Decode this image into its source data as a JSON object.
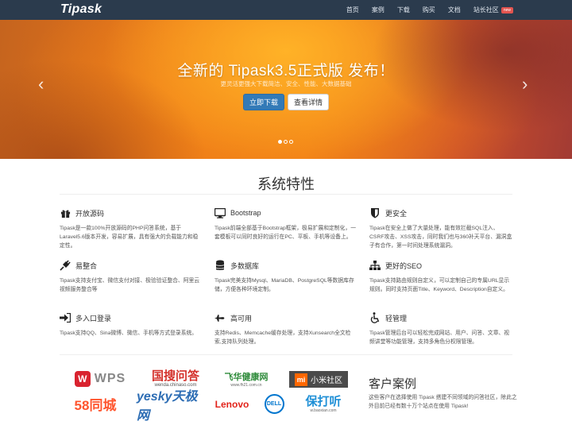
{
  "navbar": {
    "brand": "Tipask",
    "items": [
      {
        "label": "首页"
      },
      {
        "label": "案例"
      },
      {
        "label": "下载"
      },
      {
        "label": "购买"
      },
      {
        "label": "文档"
      },
      {
        "label": "站长社区",
        "badge": "new"
      }
    ]
  },
  "hero": {
    "title": "全新的 Tipask3.5正式版 发布！",
    "subtitle": "更灵活更强大下载简洁、安全、性能、大数据基础",
    "primary_button": "立即下载",
    "secondary_button": "查看详情",
    "prev_icon": "‹",
    "next_icon": "›",
    "slides_count": 3,
    "active_slide": 1
  },
  "features": {
    "title": "系统特性",
    "items": [
      {
        "icon": "gift-icon",
        "title": "开放源码",
        "desc": "Tipask是一款100%开放源码的PHP问答系统，基于Laravel5.6版本开发，容易扩展，具有强大的负载能力和稳定性。"
      },
      {
        "icon": "monitor-icon",
        "title": "Bootstrap",
        "desc": "Tipask前端全部基于Bootstrap框架，极易扩展和定制化，一套模板可以同时良好的运行在PC、平板、手机等设备上。"
      },
      {
        "icon": "shield-icon",
        "title": "更安全",
        "desc": "Tipask在安全上做了大量处理，能有效拦截SQL注入、CSRF攻击、XSS攻击，同时我们也与360补天平台、漏洞盒子有合作，第一时间处理系统漏洞。"
      },
      {
        "icon": "plug-icon",
        "title": "易整合",
        "desc": "Tipask支持支付宝、微信支付对接、极验验证整合、阿里云视频服务整合等"
      },
      {
        "icon": "database-icon",
        "title": "多数据库",
        "desc": "Tipask完美支持Mysql、MariaDB、PostgreSQL等数据库存储，方便各种环境定制。"
      },
      {
        "icon": "sitemap-icon",
        "title": "更好的SEO",
        "desc": "Tipask支持路由规则自定义，可以定制自己的专属URL显示规则。同时支持页面Title、Keyword、Description自定义。"
      },
      {
        "icon": "login-icon",
        "title": "多入口登录",
        "desc": "Tipask支持QQ、Sina微博、微信、手机等方式登录系统。"
      },
      {
        "icon": "plane-icon",
        "title": "高可用",
        "desc": "支持Redis、Memcache缓存处理，支持Xunsearch全文检索,支持队列处理。"
      },
      {
        "icon": "wheelchair-icon",
        "title": "轻管理",
        "desc": "Tipask管理后台可以轻松完成网站、用户、问答、文章、视频讲堂等功能管理，支持多角色分权限管理。"
      }
    ]
  },
  "clients": {
    "title": "客户案例",
    "desc": "这些客户在选择使用 Tipask 搭建不同领域的问答社区，除此之外目前已经有数十万个站点在使用 Tipask!",
    "logos": [
      {
        "name": "WPS",
        "color": "#d9232f"
      },
      {
        "name": "国搜问答",
        "sub": "wenda.chinaso.com",
        "color": "#d4322c"
      },
      {
        "name": "飞华健康网",
        "sub": "www.fh21.com.cn",
        "color": "#2e8b3a"
      },
      {
        "name": "小米社区",
        "color": "#ff6700"
      },
      {
        "name": "58同城",
        "color": "#ff552e"
      },
      {
        "name": "yesky天极网",
        "color": "#2d6db4"
      },
      {
        "name": "Lenovo",
        "color": "#e2231a"
      },
      {
        "name": "DELL",
        "color": "#0076ce"
      },
      {
        "name": "保打听",
        "sub": "w.baoxian.com",
        "color": "#1e8fd6"
      }
    ]
  }
}
